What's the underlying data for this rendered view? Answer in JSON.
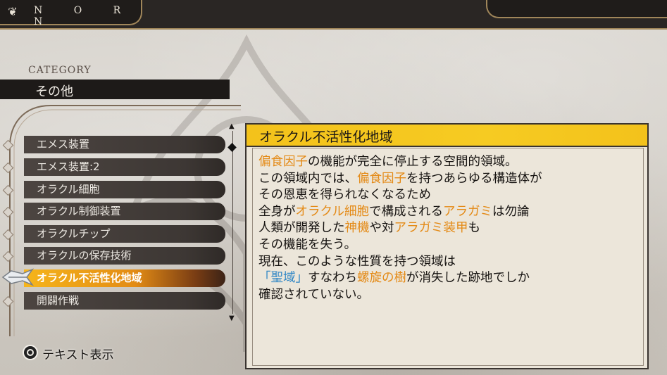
{
  "header": {
    "brand": "N O R N",
    "brand_icon": "fleur-icon"
  },
  "category": {
    "label": "CATEGORY",
    "value": "その他"
  },
  "list": {
    "items": [
      {
        "label": "エメス装置"
      },
      {
        "label": "エメス装置:2"
      },
      {
        "label": "オラクル細胞"
      },
      {
        "label": "オラクル制御装置"
      },
      {
        "label": "オラクルチップ"
      },
      {
        "label": "オラクルの保存技術"
      },
      {
        "label": "オラクル不活性化地域"
      },
      {
        "label": "開闢作戦"
      }
    ],
    "selected_index": 6
  },
  "detail": {
    "title": "オラクル不活性化地域",
    "lines": [
      [
        {
          "t": "偏食因子",
          "c": "o"
        },
        {
          "t": "の機能が完全に停止する空間的領域。",
          "c": ""
        }
      ],
      [
        {
          "t": "この領域内では、",
          "c": ""
        },
        {
          "t": "偏食因子",
          "c": "o"
        },
        {
          "t": "を持つあらゆる構造体が",
          "c": ""
        }
      ],
      [
        {
          "t": "その恩恵を得られなくなるため",
          "c": ""
        }
      ],
      [
        {
          "t": "全身が",
          "c": ""
        },
        {
          "t": "オラクル細胞",
          "c": "o"
        },
        {
          "t": "で構成される",
          "c": ""
        },
        {
          "t": "アラガミ",
          "c": "o"
        },
        {
          "t": "は勿論",
          "c": ""
        }
      ],
      [
        {
          "t": "人類が開発した",
          "c": ""
        },
        {
          "t": "神機",
          "c": "o"
        },
        {
          "t": "や対",
          "c": ""
        },
        {
          "t": "アラガミ装甲",
          "c": "o"
        },
        {
          "t": "も",
          "c": ""
        }
      ],
      [
        {
          "t": "その機能を失う。",
          "c": ""
        }
      ],
      [
        {
          "t": "現在、このような性質を持つ領域は",
          "c": ""
        }
      ],
      [
        {
          "t": "「聖域」",
          "c": "b"
        },
        {
          "t": "すなわち",
          "c": ""
        },
        {
          "t": "螺旋の樹",
          "c": "o"
        },
        {
          "t": "が消失した跡地でしか",
          "c": ""
        }
      ],
      [
        {
          "t": "確認されていない。",
          "c": ""
        }
      ]
    ]
  },
  "footer": {
    "button_icon": "circle-button-icon",
    "label": "テキスト表示"
  },
  "colors": {
    "highlight_orange": "#e48a16",
    "highlight_blue": "#2f86c5",
    "title_bar_yellow": "#f3c21b",
    "selected_item_orange": "#e38c15"
  }
}
